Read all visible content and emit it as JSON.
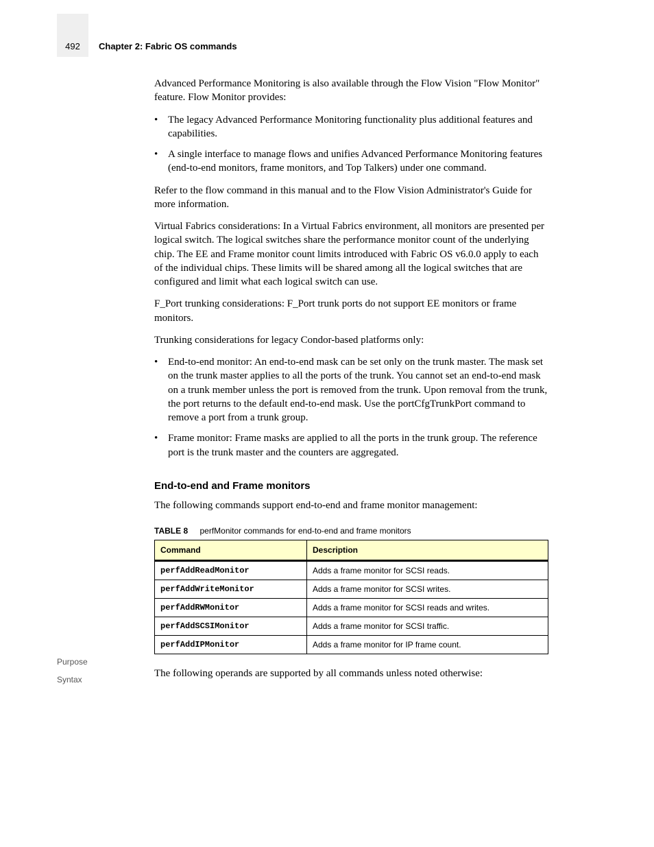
{
  "page_number": "492",
  "chapter": "Chapter 2: Fabric OS commands",
  "paragraphs": {
    "intro": "Advanced Performance Monitoring is also available through the Flow Vision \"Flow Monitor\" feature. Flow Monitor provides:",
    "after_bullets": "Refer to the flow command in this manual and to the Flow Vision Administrator's Guide for more information.",
    "ports_head": "Virtual Fabrics considerations: In a Virtual Fabrics environment, all monitors are presented per logical switch. The logical switches share the performance monitor count of the underlying chip. The EE and Frame monitor count limits introduced with Fabric OS v6.0.0 apply to each of the individual chips. These limits will be shared among all the logical switches that are configured and limit what each logical switch can use.",
    "ports_f": "F_Port trunking considerations: F_Port trunk ports do not support EE monitors or frame monitors.",
    "trunk_head": "Trunking considerations for legacy Condor-based platforms only:",
    "trunk_ee": "End-to-end monitor: An end-to-end mask can be set only on the trunk master. The mask set on the trunk master applies to all the ports of the trunk. You cannot set an end-to-end mask on a trunk member unless the port is removed from the trunk. Upon removal from the trunk, the port returns to the default end-to-end mask. Use the portCfgTrunkPort command to remove a port from a trunk group.",
    "trunk_frame": "Frame monitor: Frame masks are applied to all the ports in the trunk group. The reference port is the trunk master and the counters are aggregated.",
    "ee_sec_head": "End-to-end and Frame monitors",
    "ee_sec_body1": "The following commands support end-to-end and frame monitor management:",
    "ee_sec_body2": "The following operands are supported by all commands unless noted otherwise:"
  },
  "bullets": {
    "b1": "The legacy Advanced Performance Monitoring functionality plus additional features and capabilities.",
    "b2": "A single interface to manage flows and unifies Advanced Performance Monitoring features (end-to-end monitors, frame monitors, and Top Talkers) under one command."
  },
  "table": {
    "caption_label": "TABLE 8",
    "caption_text": "perfMonitor commands for end-to-end and frame monitors",
    "headers": {
      "cmd": "Command",
      "desc": "Description"
    },
    "rows": [
      {
        "cmd": "perfAddReadMonitor",
        "desc": "Adds a frame monitor for SCSI reads."
      },
      {
        "cmd": "perfAddWriteMonitor",
        "desc": "Adds a frame monitor for SCSI writes."
      },
      {
        "cmd": "perfAddRWMonitor",
        "desc": "Adds a frame monitor for SCSI reads and writes."
      },
      {
        "cmd": "perfAddSCSIMonitor",
        "desc": "Adds a frame monitor for SCSI traffic."
      },
      {
        "cmd": "perfAddIPMonitor",
        "desc": "Adds a frame monitor for IP frame count."
      }
    ]
  },
  "labels": {
    "purpose": "Purpose",
    "syntax": "Syntax"
  }
}
